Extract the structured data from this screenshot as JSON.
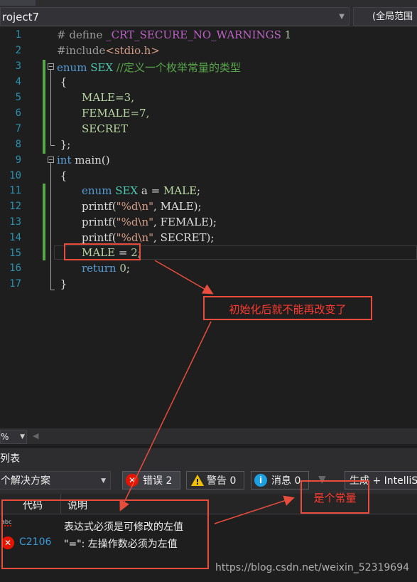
{
  "nav": {
    "project": "roject7",
    "scope": "(全局范围"
  },
  "editor": {
    "line_numbers": [
      "1",
      "2",
      "3",
      "4",
      "5",
      "6",
      "7",
      "8",
      "9",
      "10",
      "11",
      "12",
      "13",
      "14",
      "15",
      "16",
      "17"
    ],
    "code": {
      "l1_a": "# define ",
      "l1_b": "_CRT_SECURE_NO_WARNINGS",
      "l1_c": " 1",
      "l2_a": "#include",
      "l2_b": "<stdio.h>",
      "l3_a": "enum",
      "l3_b": " SEX",
      "l3_c": " //定义一个枚举常量的类型",
      "l4": " {",
      "l5": "MALE=3,",
      "l6": "FEMALE=7,",
      "l7": "SECRET",
      "l8": " };",
      "l9_a": "int",
      "l9_b": " main()",
      "l10": " {",
      "l11_a": "enum",
      "l11_b": " SEX",
      "l11_c": " a = ",
      "l11_d": "MALE",
      "l11_e": ";",
      "l12_a": "printf(",
      "l12_b": "\"%d\\n\"",
      "l12_c": ", MALE);",
      "l13_a": "printf(",
      "l13_b": "\"%d\\n\"",
      "l13_c": ", FEMALE);",
      "l14_a": "printf(",
      "l14_b": "\"%d\\n\"",
      "l14_c": ", SECRET);",
      "l15_a": "MALE",
      "l15_b": " = ",
      "l15_c": "2",
      "l15_d": ";",
      "l16_a": "return",
      "l16_b": " ",
      "l16_c": "0",
      "l16_d": ";",
      "l17": " }"
    }
  },
  "annotations": {
    "note1": "初始化后就不能再改变了",
    "note2": "是个常量"
  },
  "zoom": {
    "value": "%"
  },
  "error_list": {
    "title": "列表",
    "scope_dropdown": "个解决方案",
    "errors_btn": "错误 2",
    "warnings_btn": "警告 0",
    "messages_btn": "消息 0",
    "build_btn": "生成 + IntelliS",
    "col_code": "代码",
    "col_desc": "说明",
    "rows": [
      {
        "code": "",
        "desc": "表达式必须是可修改的左值",
        "icon": "squiggle-abc-icon"
      },
      {
        "code": "C2106",
        "desc": "\"=\": 左操作数必须为左值",
        "icon": "error-x-icon"
      }
    ]
  },
  "watermark": "https://blog.csdn.net/weixin_52319694",
  "colors": {
    "background": "#1e1e1e",
    "keyword": "#569cd6",
    "annotation": "#e74c3c",
    "error": "#e51400"
  }
}
